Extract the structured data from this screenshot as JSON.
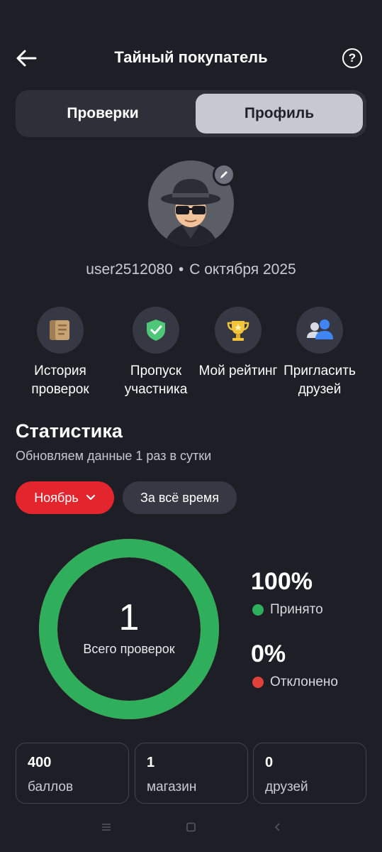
{
  "header": {
    "title": "Тайный покупатель",
    "help": "?"
  },
  "tabs": [
    {
      "label": "Проверки",
      "active": false
    },
    {
      "label": "Профиль",
      "active": true
    }
  ],
  "profile": {
    "username": "user2512080",
    "separator": "•",
    "since": "С октября 2025"
  },
  "actions": [
    {
      "label": "История проверок",
      "icon": "history-document-icon"
    },
    {
      "label": "Пропуск участника",
      "icon": "shield-check-icon"
    },
    {
      "label": "Мой рейтинг",
      "icon": "trophy-icon"
    },
    {
      "label": "Пригласить друзей",
      "icon": "users-icon"
    }
  ],
  "stats": {
    "title": "Статистика",
    "subtitle": "Обновляем данные 1 раз в сутки",
    "filter_month": "Ноябрь",
    "filter_all": "За всё время",
    "total_value": "1",
    "total_label": "Всего проверок",
    "accepted_pct": "100%",
    "accepted_label": "Принято",
    "rejected_pct": "0%",
    "rejected_label": "Отклонено",
    "accepted_fraction": 1.0,
    "colors": {
      "accepted": "#2fae5c",
      "rejected": "#e2413b",
      "accent": "#e3262e"
    }
  },
  "cards": [
    {
      "value": "400",
      "unit": "баллов"
    },
    {
      "value": "1",
      "unit": "магазин"
    },
    {
      "value": "0",
      "unit": "друзей"
    }
  ],
  "navbar": {
    "icons": [
      "menu-icon",
      "home-square-icon",
      "back-chevron-icon"
    ]
  }
}
